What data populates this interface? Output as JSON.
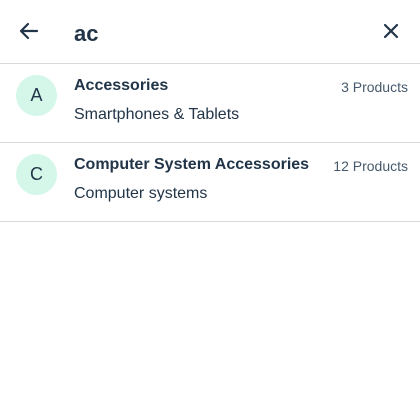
{
  "search": {
    "value": "ac",
    "back_icon": "arrow-left-icon",
    "close_icon": "close-icon"
  },
  "results": [
    {
      "initial": "A",
      "title": "Accessories",
      "subtitle": "Smartphones & Tablets",
      "count": "3 Products"
    },
    {
      "initial": "C",
      "title": "Computer System Accessories",
      "subtitle": "Computer systems",
      "count": "12 Products"
    }
  ],
  "colors": {
    "avatar_bg": "#d4f7ea",
    "text": "#223548",
    "divider": "#d9d9d9"
  }
}
